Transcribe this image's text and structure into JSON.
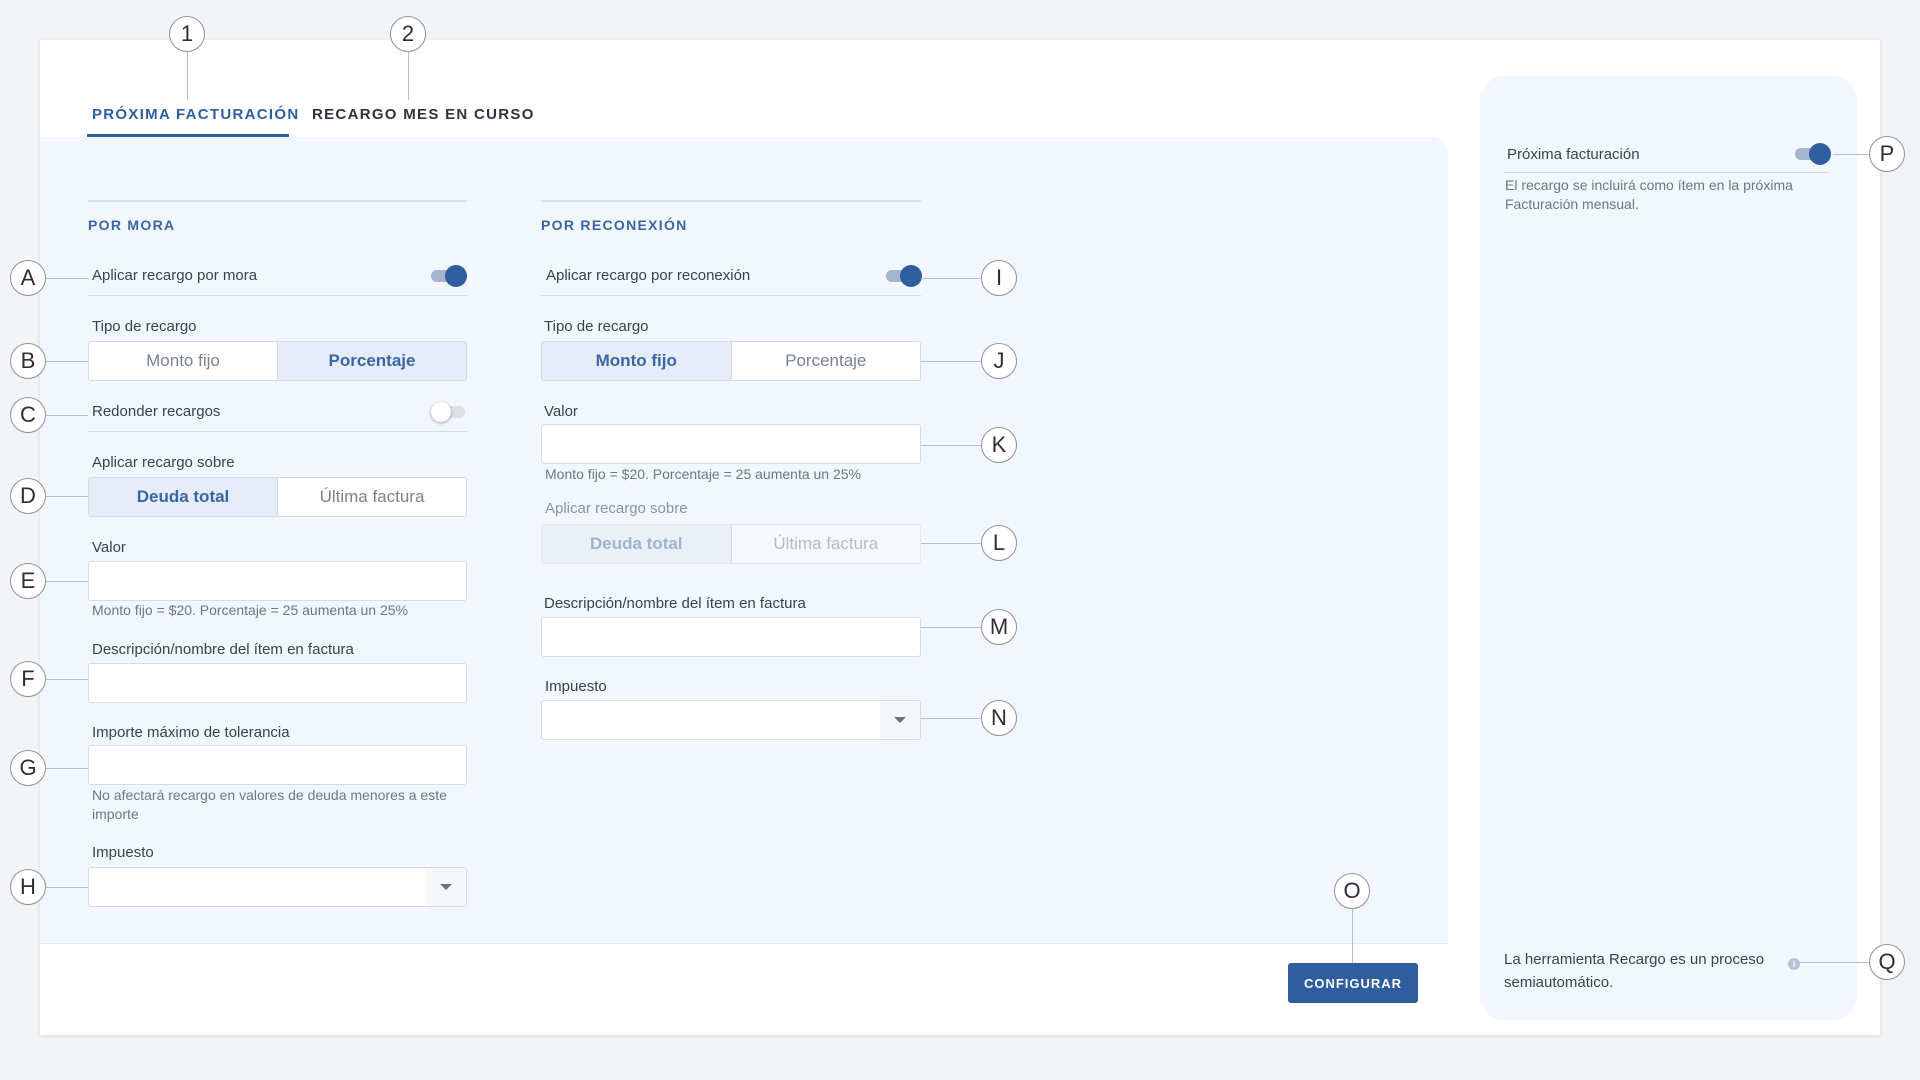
{
  "tabs": [
    {
      "label": "PRÓXIMA FACTURACIÓN",
      "active": true
    },
    {
      "label": "RECARGO MES EN CURSO",
      "active": false
    }
  ],
  "mora": {
    "title": "POR MORA",
    "apply_label": "Aplicar recargo por mora",
    "apply_on": true,
    "type_label": "Tipo de recargo",
    "type_options": [
      "Monto fijo",
      "Porcentaje"
    ],
    "type_selected": "Porcentaje",
    "round_label": "Redonder recargos",
    "round_on": false,
    "apply_on_label": "Aplicar recargo sobre",
    "apply_on_options": [
      "Deuda total",
      "Última factura"
    ],
    "apply_on_selected": "Deuda total",
    "value_label": "Valor",
    "value": "",
    "value_hint": "Monto fijo = $20. Porcentaje = 25 aumenta un 25%",
    "desc_label": "Descripción/nombre del ítem en factura",
    "desc_value": "",
    "tolerance_label": "Importe máximo de tolerancia",
    "tolerance_value": "",
    "tolerance_hint": "No afectará recargo en valores de deuda menores a este importe",
    "tax_label": "Impuesto",
    "tax_value": ""
  },
  "reconexion": {
    "title": "POR RECONEXIÓN",
    "apply_label": "Aplicar recargo por reconexión",
    "apply_on": true,
    "type_label": "Tipo de recargo",
    "type_options": [
      "Monto fijo",
      "Porcentaje"
    ],
    "type_selected": "Monto fijo",
    "value_label": "Valor",
    "value": "",
    "value_hint": "Monto fijo = $20. Porcentaje = 25 aumenta un 25%",
    "apply_on_label": "Aplicar recargo sobre",
    "apply_on_options": [
      "Deuda total",
      "Última factura"
    ],
    "apply_on_selected": "Deuda total",
    "apply_on_disabled": true,
    "desc_label": "Descripción/nombre del ítem en factura",
    "desc_value": "",
    "tax_label": "Impuesto",
    "tax_value": ""
  },
  "footer": {
    "configure_label": "CONFIGURAR"
  },
  "side": {
    "title": "Próxima facturación",
    "toggle_on": true,
    "description": "El recargo se incluirá como ítem en la próxima Facturación mensual.",
    "footer_text": "La herramienta Recargo es un proceso semiautomático.",
    "info_icon": "i"
  },
  "callouts": [
    "1",
    "2",
    "A",
    "B",
    "C",
    "D",
    "E",
    "F",
    "G",
    "H",
    "I",
    "J",
    "K",
    "L",
    "M",
    "N",
    "O",
    "P",
    "Q"
  ],
  "colors": {
    "accent": "#2f5d9e",
    "panel": "#f2f6fd",
    "background": "#f3f4f6"
  }
}
